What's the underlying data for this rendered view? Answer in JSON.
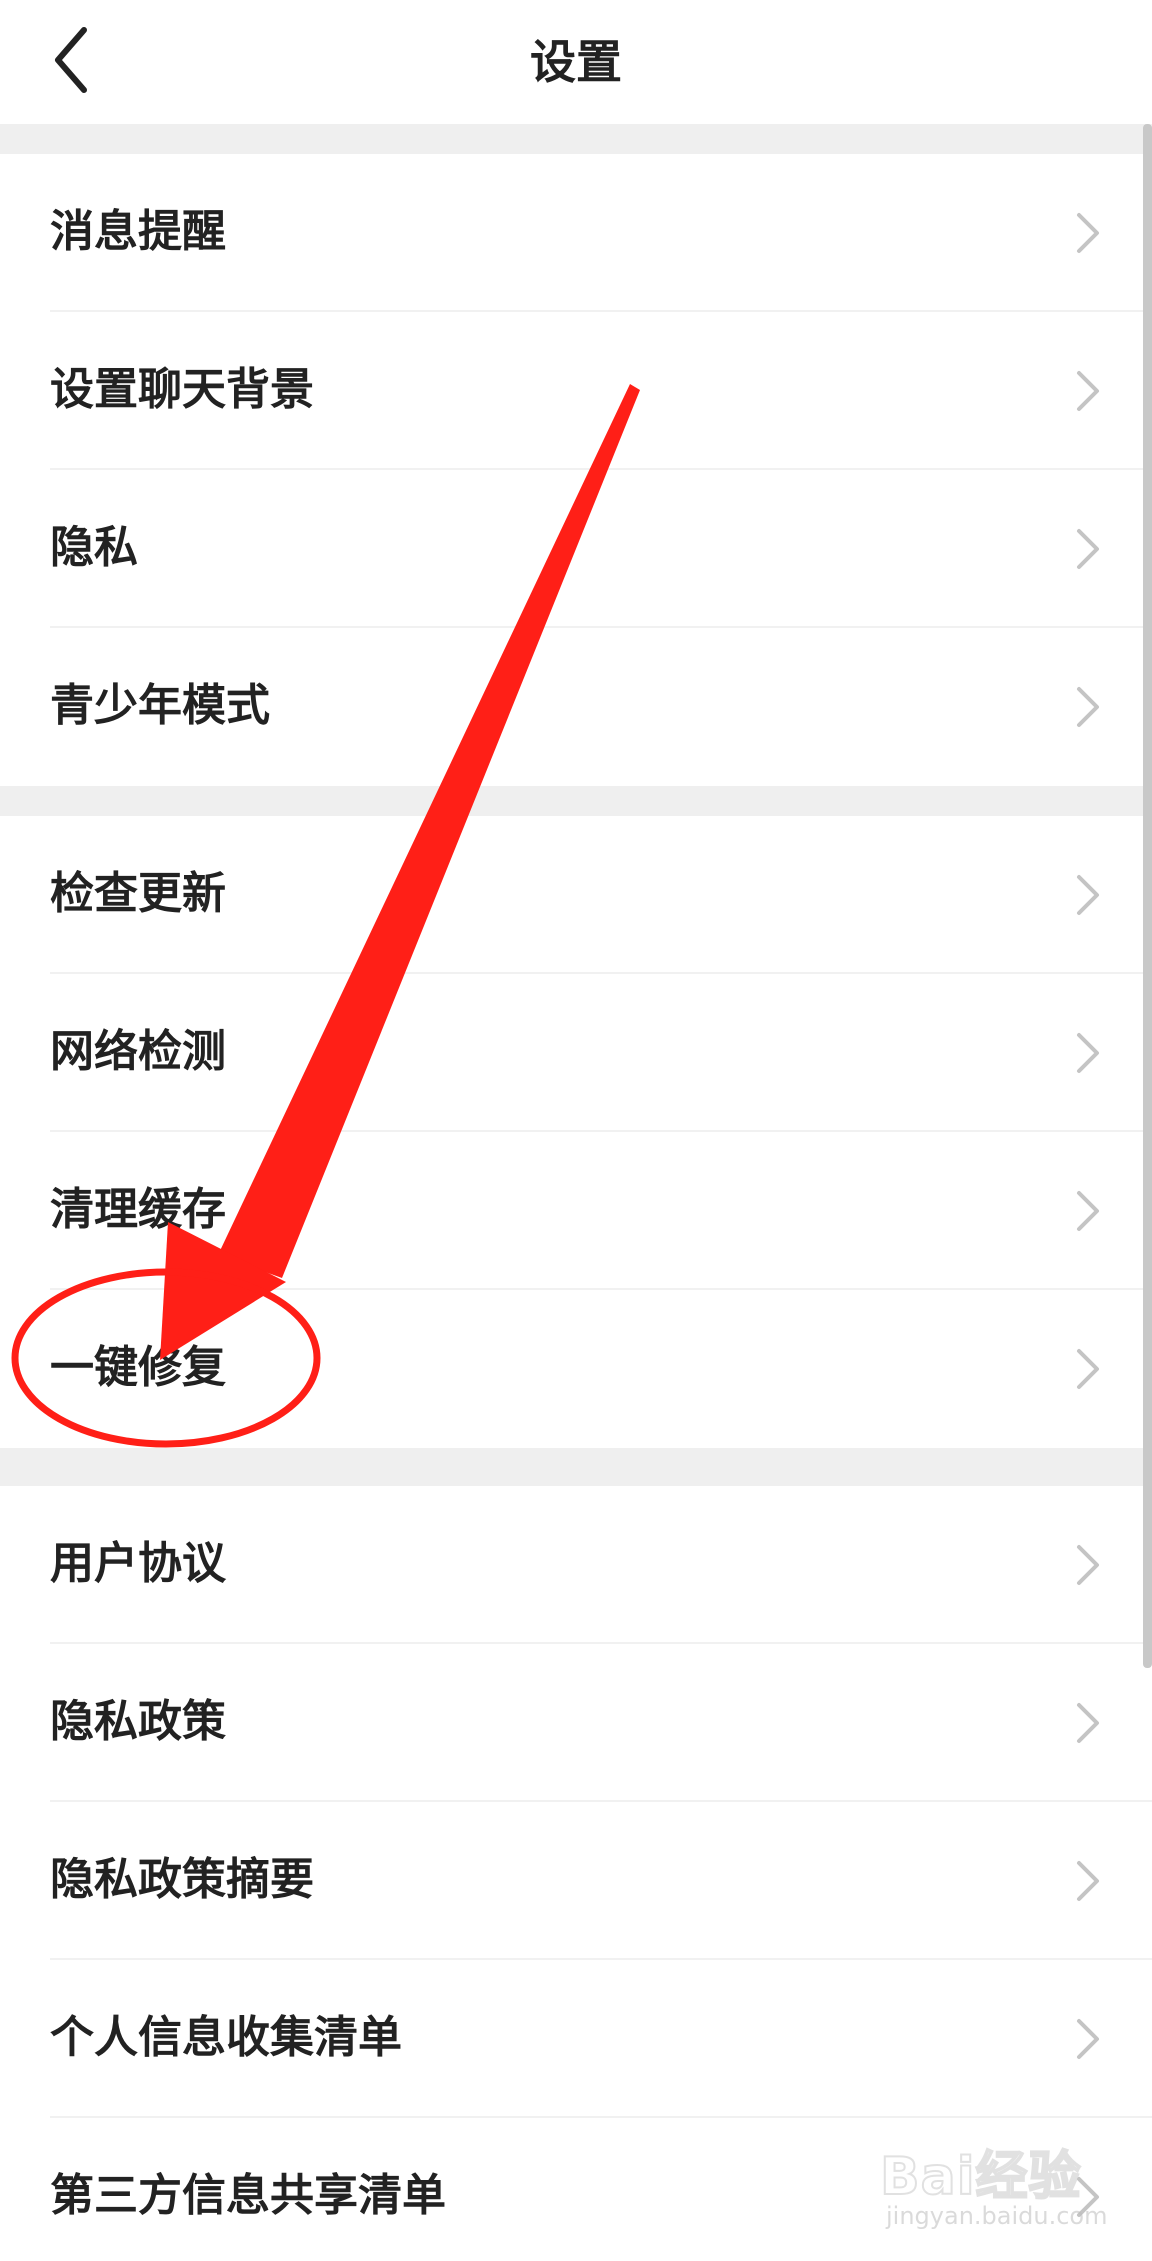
{
  "header": {
    "title": "设置",
    "back_icon": "chevron-left-icon"
  },
  "groups": [
    {
      "items": [
        {
          "label": "消息提醒"
        },
        {
          "label": "设置聊天背景"
        },
        {
          "label": "隐私"
        },
        {
          "label": "青少年模式"
        }
      ]
    },
    {
      "items": [
        {
          "label": "检查更新"
        },
        {
          "label": "网络检测"
        },
        {
          "label": "清理缓存"
        },
        {
          "label": "一键修复"
        }
      ]
    },
    {
      "items": [
        {
          "label": "用户协议"
        },
        {
          "label": "隐私政策"
        },
        {
          "label": "隐私政策摘要"
        },
        {
          "label": "个人信息收集清单"
        },
        {
          "label": "第三方信息共享清单"
        }
      ]
    }
  ],
  "annotation": {
    "color": "#ff1f17",
    "arrow_icon": "red-arrow-annotation",
    "circle_icon": "red-circle-annotation",
    "highlighted_item": "一键修复"
  },
  "watermark": {
    "text": "Bai经验",
    "sub": "jingyan.baidu.com"
  },
  "colors": {
    "background": "#ffffff",
    "gap": "#efefef",
    "text": "#222222",
    "chevron": "#c4c4c4"
  }
}
